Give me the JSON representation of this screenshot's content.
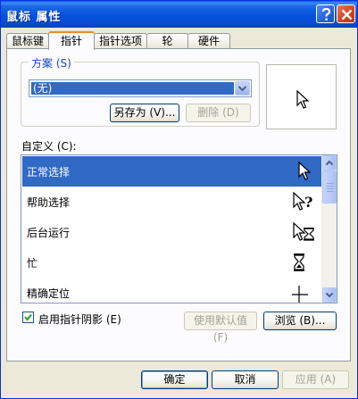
{
  "window": {
    "title": "鼠标 属性"
  },
  "tabs": [
    {
      "label": "鼠标键",
      "active": false
    },
    {
      "label": "指针",
      "active": true
    },
    {
      "label": "指针选项",
      "active": false
    },
    {
      "label": "轮",
      "active": false
    },
    {
      "label": "硬件",
      "active": false
    }
  ],
  "scheme": {
    "label": "方案 (S)",
    "selected": "(无)",
    "save_as": "另存为 (V)...",
    "delete": "删除 (D)"
  },
  "custom": {
    "label": "自定义 (C):",
    "items": [
      {
        "label": "正常选择",
        "icon": "arrow-cursor-icon",
        "selected": true
      },
      {
        "label": "帮助选择",
        "icon": "help-cursor-icon",
        "selected": false
      },
      {
        "label": "后台运行",
        "icon": "working-in-background-cursor-icon",
        "selected": false
      },
      {
        "label": "忙",
        "icon": "busy-hourglass-icon",
        "selected": false
      },
      {
        "label": "精确定位",
        "icon": "crosshair-cursor-icon",
        "selected": false
      }
    ]
  },
  "shadow": {
    "label": "启用指针阴影 (E)",
    "checked": true
  },
  "actions": {
    "use_default": "使用默认值 (F)",
    "browse": "浏览 (B)..."
  },
  "footer": {
    "ok": "确定",
    "cancel": "取消",
    "apply": "应用 (A)"
  },
  "colors": {
    "selection": "#316AC5",
    "title_bar": "#0553DB",
    "tab_highlight": "#E68B2C",
    "group_label": "#1642C8"
  }
}
